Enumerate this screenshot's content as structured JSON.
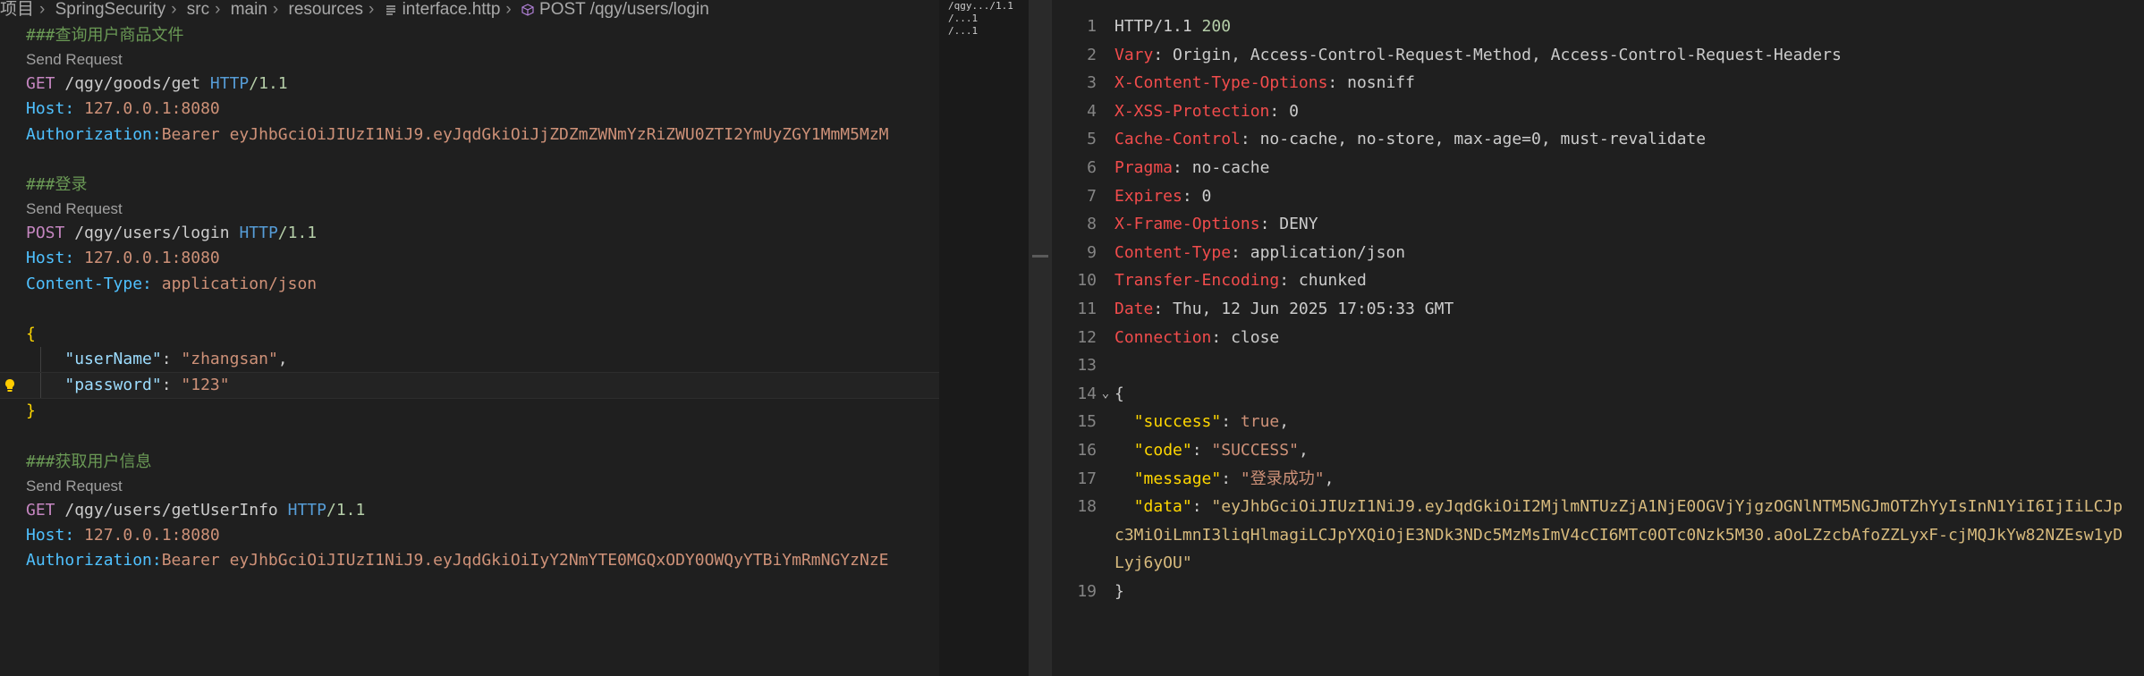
{
  "breadcrumb": {
    "items": [
      "项目",
      "SpringSecurity",
      "src",
      "main",
      "resources",
      "interface.http",
      "POST /qgy/users/login"
    ]
  },
  "editor": {
    "req1": {
      "comment": "###查询用户商品文件",
      "send": "Send Request",
      "method": "GET",
      "path": "/qgy/goods/get",
      "proto": "HTTP",
      "ver": "/1.1",
      "h1_name": "Host:",
      "h1_val": "127.0.0.1:8080",
      "h2_name": "Authorization:",
      "h2_val": "Bearer eyJhbGciOiJIUzI1NiJ9.eyJqdGkiOiJjZDZmZWNmYzRiZWU0ZTI2YmUyZGY1MmM5MzM"
    },
    "req2": {
      "comment": "###登录",
      "send": "Send Request",
      "method": "POST",
      "path": "/qgy/users/login",
      "proto": "HTTP",
      "ver": "/1.1",
      "h1_name": "Host:",
      "h1_val": "127.0.0.1:8080",
      "h2_name": "Content-Type:",
      "h2_val": "application/json",
      "open": "{",
      "k1": "\"userName\"",
      "v1": "\"zhangsan\"",
      "k2": "\"password\"",
      "v2": "\"123\"",
      "close": "}"
    },
    "req3": {
      "comment": "###获取用户信息",
      "send": "Send Request",
      "method": "GET",
      "path": "/qgy/users/getUserInfo",
      "proto": "HTTP",
      "ver": "/1.1",
      "h1_name": "Host:",
      "h1_val": "127.0.0.1:8080",
      "h2_name": "Authorization:",
      "h2_val": "Bearer eyJhbGciOiJIUzI1NiJ9.eyJqdGkiOiIyY2NmYTE0MGQxODY0OWQyYTBiYmRmNGYzNzE"
    }
  },
  "minimap": {
    "lines": [
      "/qgy.../1.1",
      "/...1",
      "/...1"
    ]
  },
  "response": {
    "status_proto": "HTTP/1.1",
    "status_code": "200",
    "headers": [
      {
        "n": "Vary",
        "v": "Origin, Access-Control-Request-Method, Access-Control-Request-Headers"
      },
      {
        "n": "X-Content-Type-Options",
        "v": "nosniff"
      },
      {
        "n": "X-XSS-Protection",
        "v": "0"
      },
      {
        "n": "Cache-Control",
        "v": "no-cache, no-store, max-age=0, must-revalidate"
      },
      {
        "n": "Pragma",
        "v": "no-cache"
      },
      {
        "n": "Expires",
        "v": "0"
      },
      {
        "n": "X-Frame-Options",
        "v": "DENY"
      },
      {
        "n": "Content-Type",
        "v": "application/json"
      },
      {
        "n": "Transfer-Encoding",
        "v": "chunked"
      },
      {
        "n": "Date",
        "v": "Thu, 12 Jun 2025 17:05:33 GMT"
      },
      {
        "n": "Connection",
        "v": "close"
      }
    ],
    "json_open": "{",
    "success_key": "\"success\"",
    "success_val": "true",
    "code_key": "\"code\"",
    "code_val": "\"SUCCESS\"",
    "message_key": "\"message\"",
    "message_val": "\"登录成功\"",
    "data_key": "\"data\"",
    "data_val": "\"eyJhbGciOiJIUzI1NiJ9.eyJqdGkiOiI2MjlmNTUzZjA1NjE0OGVjYjgzOGNlNTM5NGJmOTZhYyIsInN1YiI6IjIiLCJpc3MiOiLmnI3liqHlmagiLCJpYXQiOjE3NDk3NDc5MzMsImV4cCI6MTc0OTc0Nzk5M30.aOoLZzcbAfoZZLyxF-cjMQJkYw82NZEsw1yDLyj6yOU\"",
    "json_close": "}",
    "line_numbers": [
      "1",
      "2",
      "3",
      "4",
      "5",
      "6",
      "7",
      "8",
      "9",
      "10",
      "11",
      "12",
      "13",
      "14",
      "15",
      "16",
      "17",
      "18",
      "19"
    ]
  }
}
